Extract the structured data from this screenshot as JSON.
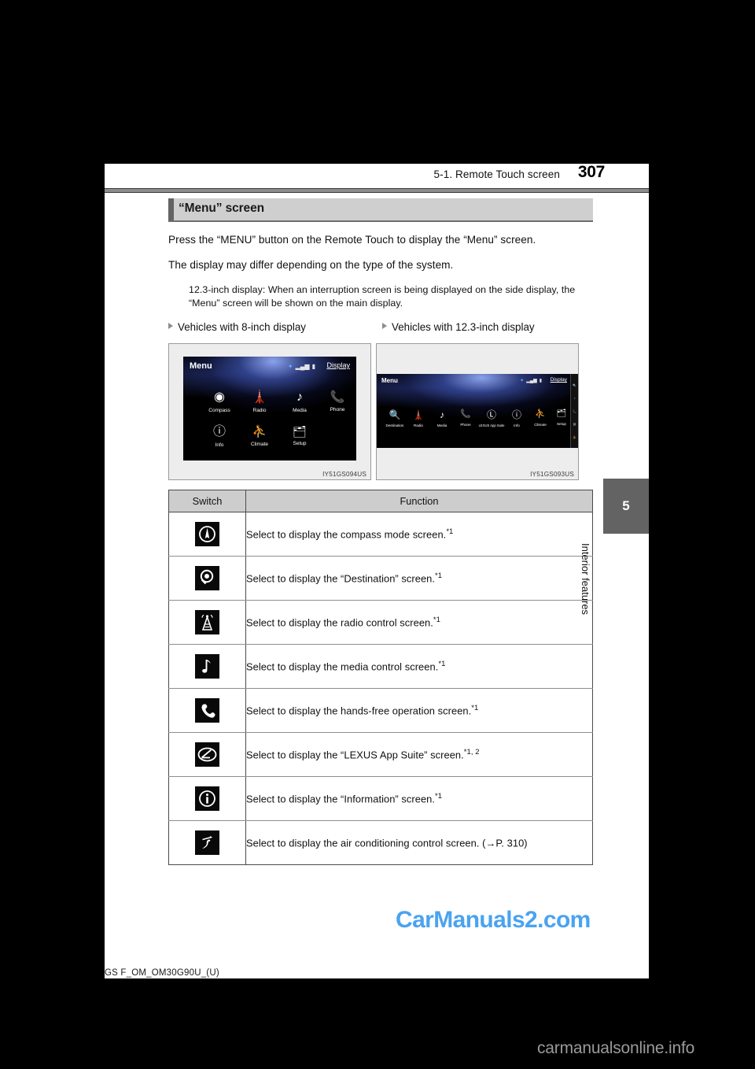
{
  "header": {
    "section_title": "5-1. Remote Touch screen",
    "page_number": "307"
  },
  "section": {
    "heading": "“Menu” screen",
    "paragraphs": [
      "Press the “MENU” button on the Remote Touch to display the “Menu” screen.",
      "The display may differ depending on the type of the system."
    ],
    "note": "12.3-inch display: When an interruption screen is being displayed on the side display, the “Menu” screen will be shown on the main display."
  },
  "subheads": {
    "left": "Vehicles with 8-inch display",
    "right": "Vehicles with 12.3-inch display"
  },
  "figures": {
    "left": {
      "caption": "IY51GS094US",
      "screen_title": "Menu",
      "display_label": "Display",
      "tiles": [
        "Compass",
        "Radio",
        "Media",
        "Phone",
        "Info",
        "Climate",
        "Setup"
      ]
    },
    "right": {
      "caption": "IY51GS093US",
      "screen_title": "Menu",
      "display_label": "Display",
      "tiles": [
        "Destination",
        "Radio",
        "Media",
        "Phone",
        "LEXUS App Suite",
        "Info",
        "Climate",
        "Setup"
      ]
    }
  },
  "table": {
    "headers": [
      "Switch",
      "Function"
    ],
    "rows": [
      {
        "icon": "compass-icon",
        "text": "Select to display the compass mode screen.",
        "footnote": "*1"
      },
      {
        "icon": "destination-search-icon",
        "text": "Select to display the “Destination” screen.",
        "footnote": "*1"
      },
      {
        "icon": "radio-tower-icon",
        "text": "Select to display the radio control screen.",
        "footnote": "*1"
      },
      {
        "icon": "music-note-icon",
        "text": "Select to display the media control screen.",
        "footnote": "*1"
      },
      {
        "icon": "phone-handset-icon",
        "text": "Select to display the hands-free operation screen.",
        "footnote": "*1"
      },
      {
        "icon": "lexus-logo-icon",
        "text": "Select to display the “LEXUS App Suite” screen.",
        "footnote": "*1, 2"
      },
      {
        "icon": "information-icon",
        "text": "Select to display the “Information” screen.",
        "footnote": "*1"
      },
      {
        "icon": "climate-seat-icon",
        "text": "Select to display the air conditioning control screen. (→P. 310)",
        "footnote": ""
      }
    ]
  },
  "side_tab": {
    "number": "5",
    "label": "Interior features"
  },
  "watermarks": {
    "center": "CarManuals2.com",
    "bottom": "carmanualsonline.info"
  },
  "footer_code": "GS F_OM_OM30G90U_(U)",
  "colors": {
    "accent_gray": "#636363",
    "heading_bg": "#cfcfcf",
    "watermark_blue": "#4aa3f0"
  }
}
